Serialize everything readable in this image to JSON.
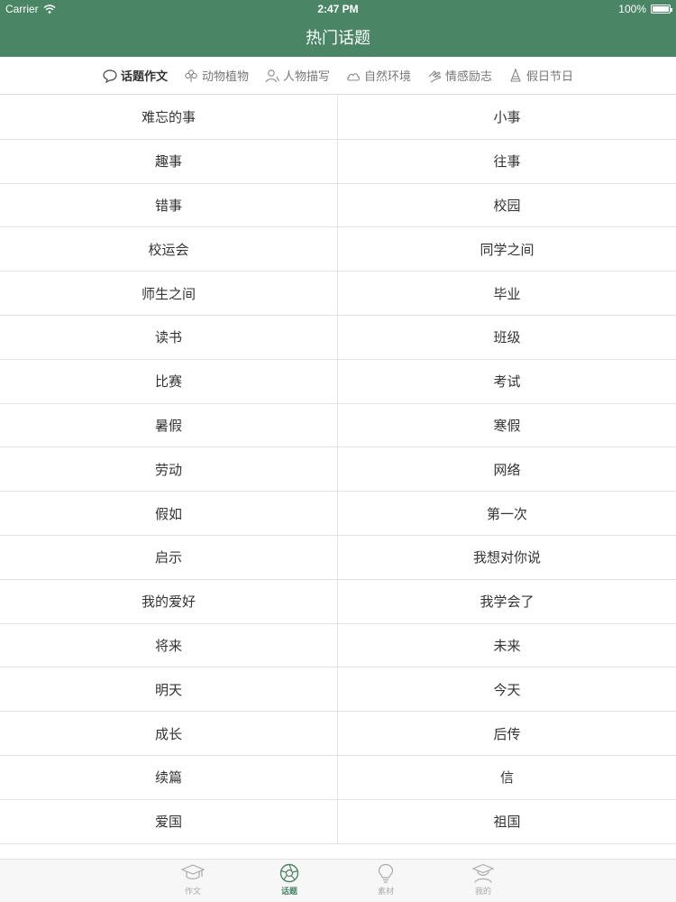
{
  "status_bar": {
    "carrier": "Carrier",
    "time": "2:47 PM",
    "battery": "100%"
  },
  "nav": {
    "title": "热门话题"
  },
  "categories": [
    {
      "label": "话题作文",
      "icon": "speech-bubble-icon",
      "active": true
    },
    {
      "label": "动物植物",
      "icon": "flower-icon",
      "active": false
    },
    {
      "label": "人物描写",
      "icon": "person-icon",
      "active": false
    },
    {
      "label": "自然环境",
      "icon": "cloud-icon",
      "active": false
    },
    {
      "label": "情感励志",
      "icon": "hand-icon",
      "active": false
    },
    {
      "label": "假日节日",
      "icon": "party-hat-icon",
      "active": false
    }
  ],
  "topics": [
    [
      "难忘的事",
      "小事"
    ],
    [
      "趣事",
      "往事"
    ],
    [
      "错事",
      "校园"
    ],
    [
      "校运会",
      "同学之间"
    ],
    [
      "师生之间",
      "毕业"
    ],
    [
      "读书",
      "班级"
    ],
    [
      "比赛",
      "考试"
    ],
    [
      "暑假",
      "寒假"
    ],
    [
      "劳动",
      "网络"
    ],
    [
      "假如",
      "第一次"
    ],
    [
      "启示",
      "我想对你说"
    ],
    [
      "我的爱好",
      "我学会了"
    ],
    [
      "将来",
      "未来"
    ],
    [
      "明天",
      "今天"
    ],
    [
      "成长",
      "后传"
    ],
    [
      "续篇",
      "信"
    ],
    [
      "爱国",
      "祖国"
    ]
  ],
  "tabs": [
    {
      "label": "作文",
      "icon": "graduation-cap-icon",
      "active": false
    },
    {
      "label": "话题",
      "icon": "aperture-icon",
      "active": true
    },
    {
      "label": "素材",
      "icon": "lightbulb-icon",
      "active": false
    },
    {
      "label": "我的",
      "icon": "student-icon",
      "active": false
    }
  ],
  "colors": {
    "brand": "#4a8566",
    "divider": "#e3e3e3",
    "text": "#333333",
    "inactive": "#aaaaaa"
  }
}
